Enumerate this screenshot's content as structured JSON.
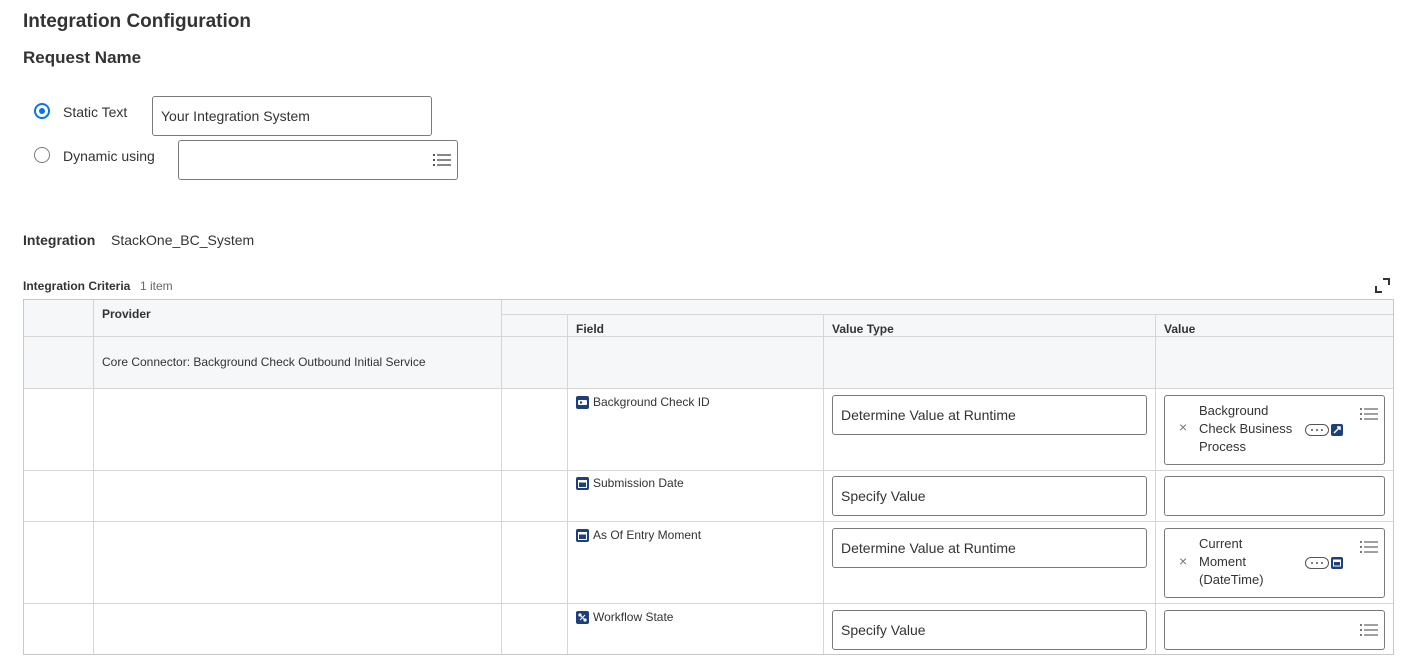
{
  "header": {
    "title": "Integration Configuration",
    "subtitle": "Request Name"
  },
  "request_name": {
    "static_label": "Static Text",
    "static_selected": true,
    "static_value": "Your Integration System",
    "dynamic_label": "Dynamic using",
    "dynamic_value": ""
  },
  "integration": {
    "label": "Integration",
    "value": "StackOne_BC_System"
  },
  "criteria": {
    "title": "Integration Criteria",
    "count": "1 item",
    "columns": {
      "provider": "Provider",
      "field": "Field",
      "value_type": "Value Type",
      "value": "Value"
    },
    "provider_name": "Core Connector: Background Check Outbound Initial Service",
    "rows": [
      {
        "field": "Background Check ID",
        "field_icon": "id-icon",
        "value_type": "Determine Value at Runtime",
        "value_lines": [
          "Background",
          "Check Business",
          "Process"
        ]
      },
      {
        "field": "Submission Date",
        "field_icon": "calendar-icon",
        "value_type": "Specify Value",
        "value_lines": []
      },
      {
        "field": "As Of Entry Moment",
        "field_icon": "calendar-icon",
        "value_type": "Determine Value at Runtime",
        "value_lines": [
          "Current",
          "Moment",
          "(DateTime)"
        ]
      },
      {
        "field": "Workflow State",
        "field_icon": "workflow-icon",
        "value_type": "Specify Value",
        "value_lines": []
      }
    ]
  },
  "colors": {
    "accent": "#0875e1",
    "field_icon_bg": "#1d3f7a",
    "grid_header_bg": "#f6f7f8",
    "border": "#7b7b7b"
  }
}
